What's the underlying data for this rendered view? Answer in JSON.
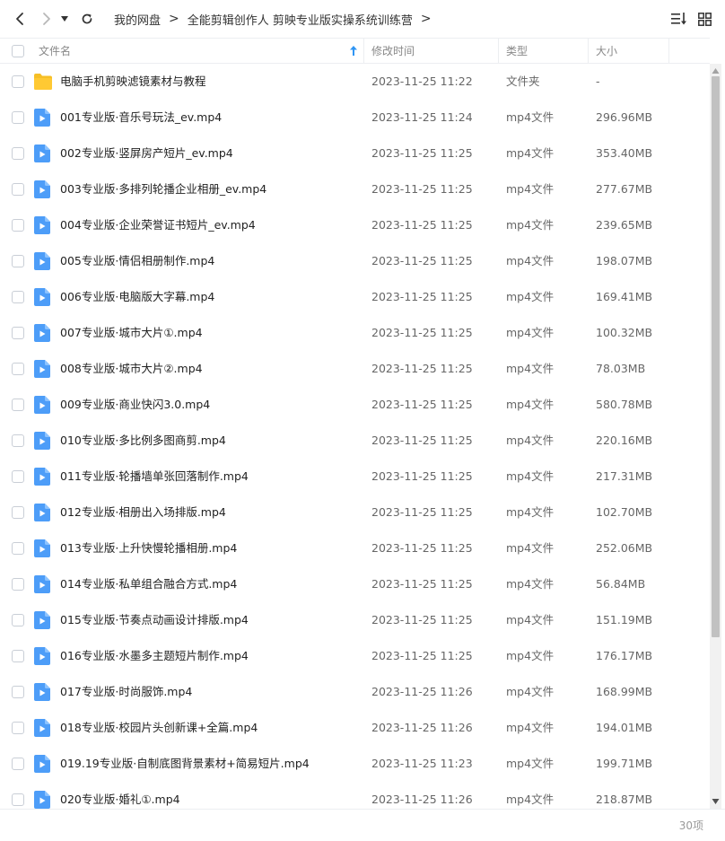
{
  "breadcrumb": [
    {
      "label": "我的网盘"
    },
    {
      "label": "全能剪辑创作人 剪映专业版实操系统训练营"
    }
  ],
  "columns": {
    "name": "文件名",
    "mtime": "修改时间",
    "type": "类型",
    "size": "大小"
  },
  "sort": {
    "column": "name",
    "direction": "asc"
  },
  "files": [
    {
      "kind": "folder",
      "name": "电脑手机剪映滤镜素材与教程",
      "mtime": "2023-11-25 11:22",
      "type": "文件夹",
      "size": "-"
    },
    {
      "kind": "video",
      "name": "001专业版·音乐号玩法_ev.mp4",
      "mtime": "2023-11-25 11:24",
      "type": "mp4文件",
      "size": "296.96MB"
    },
    {
      "kind": "video",
      "name": "002专业版·竖屏房产短片_ev.mp4",
      "mtime": "2023-11-25 11:25",
      "type": "mp4文件",
      "size": "353.40MB"
    },
    {
      "kind": "video",
      "name": "003专业版·多排列轮播企业相册_ev.mp4",
      "mtime": "2023-11-25 11:25",
      "type": "mp4文件",
      "size": "277.67MB"
    },
    {
      "kind": "video",
      "name": "004专业版·企业荣誉证书短片_ev.mp4",
      "mtime": "2023-11-25 11:25",
      "type": "mp4文件",
      "size": "239.65MB"
    },
    {
      "kind": "video",
      "name": "005专业版·情侣相册制作.mp4",
      "mtime": "2023-11-25 11:25",
      "type": "mp4文件",
      "size": "198.07MB"
    },
    {
      "kind": "video",
      "name": "006专业版·电脑版大字幕.mp4",
      "mtime": "2023-11-25 11:25",
      "type": "mp4文件",
      "size": "169.41MB"
    },
    {
      "kind": "video",
      "name": "007专业版·城市大片①.mp4",
      "mtime": "2023-11-25 11:25",
      "type": "mp4文件",
      "size": "100.32MB"
    },
    {
      "kind": "video",
      "name": "008专业版·城市大片②.mp4",
      "mtime": "2023-11-25 11:25",
      "type": "mp4文件",
      "size": "78.03MB"
    },
    {
      "kind": "video",
      "name": "009专业版·商业快闪3.0.mp4",
      "mtime": "2023-11-25 11:25",
      "type": "mp4文件",
      "size": "580.78MB"
    },
    {
      "kind": "video",
      "name": "010专业版·多比例多图商剪.mp4",
      "mtime": "2023-11-25 11:25",
      "type": "mp4文件",
      "size": "220.16MB"
    },
    {
      "kind": "video",
      "name": "011专业版·轮播墙单张回落制作.mp4",
      "mtime": "2023-11-25 11:25",
      "type": "mp4文件",
      "size": "217.31MB"
    },
    {
      "kind": "video",
      "name": "012专业版·相册出入场排版.mp4",
      "mtime": "2023-11-25 11:25",
      "type": "mp4文件",
      "size": "102.70MB"
    },
    {
      "kind": "video",
      "name": "013专业版·上升快慢轮播相册.mp4",
      "mtime": "2023-11-25 11:25",
      "type": "mp4文件",
      "size": "252.06MB"
    },
    {
      "kind": "video",
      "name": "014专业版·私单组合融合方式.mp4",
      "mtime": "2023-11-25 11:25",
      "type": "mp4文件",
      "size": "56.84MB"
    },
    {
      "kind": "video",
      "name": "015专业版·节奏点动画设计排版.mp4",
      "mtime": "2023-11-25 11:25",
      "type": "mp4文件",
      "size": "151.19MB"
    },
    {
      "kind": "video",
      "name": "016专业版·水墨多主题短片制作.mp4",
      "mtime": "2023-11-25 11:25",
      "type": "mp4文件",
      "size": "176.17MB"
    },
    {
      "kind": "video",
      "name": "017专业版·时尚服饰.mp4",
      "mtime": "2023-11-25 11:26",
      "type": "mp4文件",
      "size": "168.99MB"
    },
    {
      "kind": "video",
      "name": "018专业版·校园片头创新课+全篇.mp4",
      "mtime": "2023-11-25 11:26",
      "type": "mp4文件",
      "size": "194.01MB"
    },
    {
      "kind": "video",
      "name": "019.19专业版·自制底图背景素材+简易短片.mp4",
      "mtime": "2023-11-25 11:23",
      "type": "mp4文件",
      "size": "199.71MB"
    },
    {
      "kind": "video",
      "name": "020专业版·婚礼①.mp4",
      "mtime": "2023-11-25 11:26",
      "type": "mp4文件",
      "size": "218.87MB"
    }
  ],
  "footer": {
    "count": "30项"
  },
  "icons": {
    "back": "chevron-left-icon",
    "forward": "chevron-right-icon",
    "history": "caret-down-icon",
    "refresh": "refresh-icon",
    "sort": "sort-list-icon",
    "grid": "grid-view-icon",
    "folder": "folder-icon",
    "video": "video-file-icon"
  },
  "colors": {
    "folder": "#f6bf26",
    "video": "#4d9df8",
    "accent": "#2f95f4",
    "border": "#eceef1"
  },
  "scroll_position": 0.0
}
